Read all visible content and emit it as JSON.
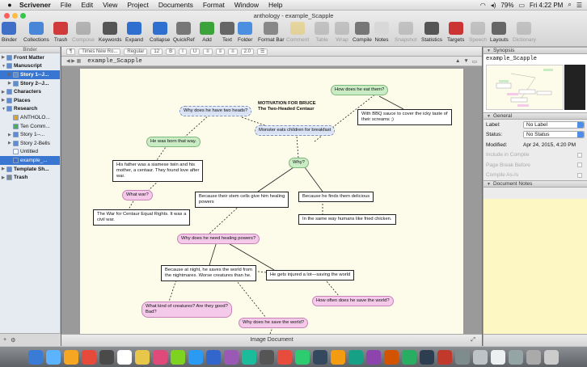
{
  "menubar": {
    "app_name": "Scrivener",
    "items": [
      "File",
      "Edit",
      "View",
      "Project",
      "Documents",
      "Format",
      "Window",
      "Help"
    ],
    "battery": "79%",
    "clock": "Fri 4:22 PM"
  },
  "window": {
    "title": "anthology - example_Scapple"
  },
  "toolbar": {
    "buttons": [
      {
        "label": "Binder",
        "color": "#3f6fc6",
        "enabled": true,
        "icon": "binder-icon"
      },
      {
        "label": "Collections",
        "color": "#4a86d8",
        "enabled": true,
        "icon": "collections-icon"
      },
      {
        "label": "Trash",
        "color": "#d03a3a",
        "enabled": true,
        "icon": "trash-icon"
      },
      {
        "label": "Compose",
        "color": "#777777",
        "enabled": false,
        "icon": "compose-icon"
      },
      {
        "label": "Keywords",
        "color": "#555555",
        "enabled": true,
        "icon": "keywords-icon"
      },
      {
        "label": "Expand",
        "color": "#2f6fd0",
        "enabled": true,
        "icon": "expand-icon"
      },
      {
        "label": "Collapse",
        "color": "#2f6fd0",
        "enabled": true,
        "icon": "collapse-icon"
      },
      {
        "label": "QuickRef",
        "color": "#777777",
        "enabled": true,
        "icon": "quickref-icon"
      },
      {
        "label": "Add",
        "color": "#3aa43a",
        "enabled": true,
        "icon": "add-icon"
      },
      {
        "label": "Text",
        "color": "#666666",
        "enabled": true,
        "icon": "text-icon"
      },
      {
        "label": "Folder",
        "color": "#4c8fe0",
        "enabled": true,
        "icon": "folder-icon"
      },
      {
        "label": "Format Bar",
        "color": "#888888",
        "enabled": true,
        "icon": "format-bar-icon"
      },
      {
        "label": "Comment",
        "color": "#e8c64a",
        "enabled": false,
        "icon": "comment-icon"
      },
      {
        "label": "Table",
        "color": "#999999",
        "enabled": false,
        "icon": "table-icon"
      },
      {
        "label": "Wrap",
        "color": "#999999",
        "enabled": false,
        "icon": "wrap-icon"
      },
      {
        "label": "Compile",
        "color": "#777777",
        "enabled": true,
        "icon": "compile-icon"
      },
      {
        "label": "Notes",
        "color": "#d8d8d8",
        "enabled": true,
        "icon": "notes-icon"
      },
      {
        "label": "Snapshot",
        "color": "#999999",
        "enabled": false,
        "icon": "snapshot-icon"
      },
      {
        "label": "Statistics",
        "color": "#555555",
        "enabled": true,
        "icon": "statistics-icon"
      },
      {
        "label": "Targets",
        "color": "#cc3333",
        "enabled": true,
        "icon": "targets-icon"
      },
      {
        "label": "Speech",
        "color": "#999999",
        "enabled": false,
        "icon": "speech-icon"
      },
      {
        "label": "Layouts",
        "color": "#666666",
        "enabled": true,
        "icon": "layouts-icon"
      },
      {
        "label": "Dictionary",
        "color": "#999999",
        "enabled": false,
        "icon": "dictionary-icon"
      }
    ]
  },
  "binder": {
    "header": "Binder",
    "items": [
      {
        "label": "Front Matter",
        "level": 0,
        "bold": true,
        "arrow": "▶",
        "icon": "#5b8ed6"
      },
      {
        "label": "Manuscript",
        "level": 0,
        "bold": true,
        "arrow": "▼",
        "icon": "#5b8ed6"
      },
      {
        "label": "Story 1--J...",
        "level": 1,
        "bold": true,
        "arrow": "▶",
        "icon": "#5b8ed6",
        "selected": true
      },
      {
        "label": "Story 2--J...",
        "level": 1,
        "bold": true,
        "arrow": "▶",
        "icon": "#5b8ed6"
      },
      {
        "label": "Characters",
        "level": 0,
        "bold": true,
        "arrow": "▶",
        "icon": "#5b8ed6"
      },
      {
        "label": "Places",
        "level": 0,
        "bold": true,
        "arrow": "▶",
        "icon": "#5b8ed6"
      },
      {
        "label": "Research",
        "level": 0,
        "bold": true,
        "arrow": "▼",
        "icon": "#5b8ed6"
      },
      {
        "label": "ANTHOLO...",
        "level": 1,
        "bold": false,
        "arrow": "",
        "icon": "#e0a030"
      },
      {
        "label": "Ten Comm...",
        "level": 1,
        "bold": false,
        "arrow": "",
        "icon": "#4caf50"
      },
      {
        "label": "Story 1--...",
        "level": 1,
        "bold": false,
        "arrow": "▶",
        "icon": "#5b8ed6"
      },
      {
        "label": "Story 2-Bells",
        "level": 1,
        "bold": false,
        "arrow": "▶",
        "icon": "#5b8ed6"
      },
      {
        "label": "Untitled",
        "level": 1,
        "bold": false,
        "arrow": "",
        "icon": "#ffffff"
      },
      {
        "label": "example_...",
        "level": 1,
        "bold": false,
        "arrow": "",
        "icon": "#3a6fd0",
        "selected": true
      },
      {
        "label": "Template Sh...",
        "level": 0,
        "bold": true,
        "arrow": "▶",
        "icon": "#5b8ed6"
      },
      {
        "label": "Trash",
        "level": 0,
        "bold": true,
        "arrow": "▶",
        "icon": "#888888"
      }
    ]
  },
  "format_bar": {
    "font": "Times New Ro...",
    "style": "Regular",
    "size": "12",
    "spacing": "2.0"
  },
  "editor": {
    "doc_name": "example_Scapple",
    "footer": "Image Document",
    "nodes": [
      {
        "id": "q-eat",
        "text": "How does he eat them?",
        "style": "green"
      },
      {
        "id": "bbq",
        "text": "With BBQ sauce to cover the icky taste of\ntheir screams ;)",
        "style": "box"
      },
      {
        "id": "q-heads",
        "text": "Why does he have two heads?",
        "style": "cloud"
      },
      {
        "id": "motivation",
        "text": "MOTIVATION FOR BRUCE\nThe Two-Headed Centaur",
        "style": "plain"
      },
      {
        "id": "monster",
        "text": "Monster eats children for breakfast",
        "style": "cloud"
      },
      {
        "id": "born",
        "text": "He was born that way.",
        "style": "green"
      },
      {
        "id": "siamese",
        "text": "His father was a siamese twin and his\nmother, a centaur. They found love after\nwar.",
        "style": "box"
      },
      {
        "id": "why",
        "text": "Why?",
        "style": "green"
      },
      {
        "id": "whatwar",
        "text": "What war?",
        "style": "pink"
      },
      {
        "id": "stemcells",
        "text": "Because their stem cells give him healing\npowers",
        "style": "box"
      },
      {
        "id": "delicious",
        "text": "Because he finds them delicious",
        "style": "box"
      },
      {
        "id": "waroncentaur",
        "text": "The War for Centaur Equal Rights. It was a\ncivil war.",
        "style": "box"
      },
      {
        "id": "friedchicken",
        "text": "In the same way humans like fried chicken.",
        "style": "box"
      },
      {
        "id": "q-healing",
        "text": "Why does he need healing powers?",
        "style": "pink"
      },
      {
        "id": "night",
        "text": "Because at night, he saves the world from\nthe nightmares. Worse creatures than he.",
        "style": "box"
      },
      {
        "id": "hurt",
        "text": "He gets injured a lot—saving the world",
        "style": "box"
      },
      {
        "id": "q-often",
        "text": "How often does he save the world?",
        "style": "pink"
      },
      {
        "id": "q-creatures",
        "text": "What kind of creatures? Are they good?\nBad?",
        "style": "pink"
      },
      {
        "id": "q-save",
        "text": "Why does he save the world?",
        "style": "pink"
      }
    ]
  },
  "inspector": {
    "synopsis_header": "Synopsis",
    "synopsis_title": "example_Scapple",
    "general_header": "General",
    "label_key": "Label:",
    "label_value": "No Label",
    "status_key": "Status:",
    "status_value": "No Status",
    "modified_key": "Modified:",
    "modified_value": "Apr 24, 2015, 4:20 PM",
    "include_compile": "Include in Compile",
    "page_break": "Page Break Before",
    "compile_as_is": "Compile As-Is",
    "notes_header": "Document Notes"
  }
}
